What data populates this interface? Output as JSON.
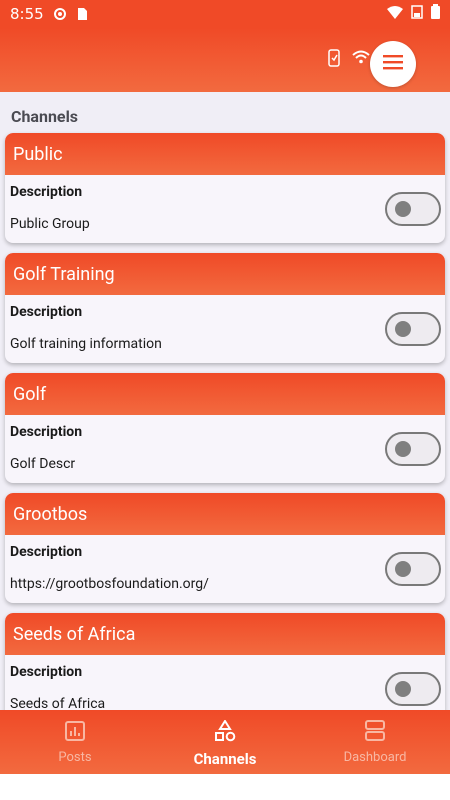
{
  "status_bar": {
    "time": "8:55",
    "icons": [
      "gear-icon",
      "sd-card-icon",
      "wifi-icon",
      "battery-icon"
    ]
  },
  "app_bar": {
    "icons": [
      "phone-check-icon",
      "wifi-icon"
    ],
    "menu_icon": "menu-icon"
  },
  "section": {
    "title": "Channels"
  },
  "channels": [
    {
      "name": "Public",
      "description_label": "Description",
      "description": "Public Group",
      "enabled": false
    },
    {
      "name": "Golf Training",
      "description_label": "Description",
      "description": "Golf training information",
      "enabled": false
    },
    {
      "name": "Golf",
      "description_label": "Description",
      "description": "Golf Descr",
      "enabled": false
    },
    {
      "name": "Grootbos",
      "description_label": "Description",
      "description": "https://grootbosfoundation.org/",
      "enabled": false
    },
    {
      "name": "Seeds of Africa",
      "description_label": "Description",
      "description": "Seeds of Africa",
      "enabled": false
    }
  ],
  "bottom_nav": {
    "items": [
      {
        "label": "Posts",
        "icon": "chart-icon",
        "active": false
      },
      {
        "label": "Channels",
        "icon": "shapes-icon",
        "active": true
      },
      {
        "label": "Dashboard",
        "icon": "dashboard-icon",
        "active": false
      }
    ]
  },
  "colors": {
    "accent": "#f04a27",
    "accent_light": "#f26a3f",
    "background": "#f0eef6",
    "card": "#f8f5fb"
  }
}
